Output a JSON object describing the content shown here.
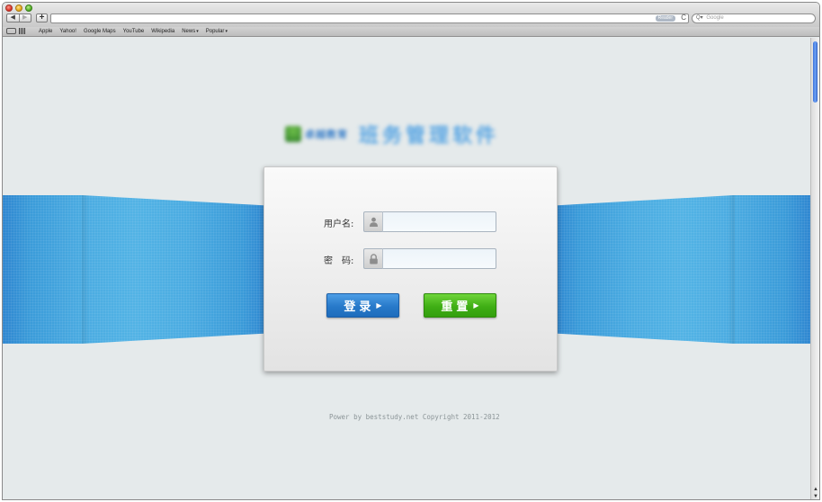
{
  "browser": {
    "nav_back": "◀",
    "nav_forward": "▶",
    "add_tab": "+",
    "reader_label": "Reader",
    "reload": "C",
    "search_placeholder": "Google",
    "bookmarks": [
      {
        "label": "Apple"
      },
      {
        "label": "Yahoo!"
      },
      {
        "label": "Google Maps"
      },
      {
        "label": "YouTube"
      },
      {
        "label": "Wikipedia"
      },
      {
        "label": "News"
      },
      {
        "label": "Popular"
      }
    ],
    "dropdown_mark": "▾"
  },
  "login": {
    "logo_small": "卓越教育",
    "logo_big": "班务管理软件",
    "username_label": "用户名:",
    "password_label": "密　码:",
    "username_value": "",
    "password_value": "",
    "login_button": "登录",
    "reset_button": "重置",
    "button_arrow": "▶"
  },
  "footer": {
    "copyright": "Power by beststudy.net Copyright 2011-2012"
  },
  "colors": {
    "band_blue": "#4aabe1",
    "login_blue": "#2779c9",
    "reset_green": "#3fae15",
    "page_background": "#e5eaeb"
  }
}
